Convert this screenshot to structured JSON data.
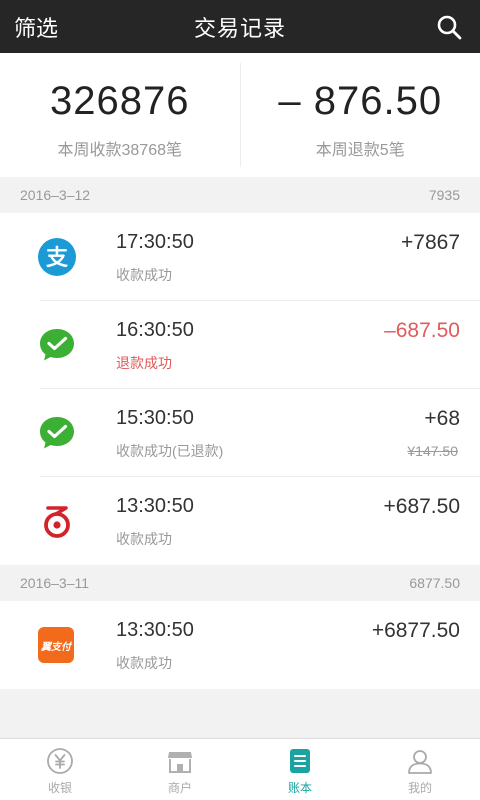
{
  "header": {
    "filter_label": "筛选",
    "title": "交易记录"
  },
  "summary": {
    "income_value": "326876",
    "income_label": "本周收款38768笔",
    "refund_value": "– 876.50",
    "refund_label": "本周退款5笔"
  },
  "groups": [
    {
      "date": "2016–3–12",
      "total": "7935",
      "items": [
        {
          "icon": "alipay-icon",
          "time": "17:30:50",
          "status": "收款成功",
          "amount": "+7867"
        },
        {
          "icon": "wechat-pay-icon",
          "time": "16:30:50",
          "status": "退款成功",
          "amount": "–687.50"
        },
        {
          "icon": "wechat-pay-icon",
          "time": "15:30:50",
          "status": "收款成功(已退款)",
          "amount": "+68",
          "original": "¥147.50"
        },
        {
          "icon": "lakala-icon",
          "time": "13:30:50",
          "status": "收款成功",
          "amount": "+687.50"
        }
      ]
    },
    {
      "date": "2016–3–11",
      "total": "6877.50",
      "items": [
        {
          "icon": "yizhifu-icon",
          "icon_text": "翼支付",
          "time": "13:30:50",
          "status": "收款成功",
          "amount": "+6877.50"
        }
      ]
    }
  ],
  "tabs": [
    {
      "label": "收银",
      "icon": "cashier-icon"
    },
    {
      "label": "商户",
      "icon": "store-icon"
    },
    {
      "label": "账本",
      "icon": "ledger-icon",
      "active": true
    },
    {
      "label": "我的",
      "icon": "profile-icon"
    }
  ],
  "colors": {
    "header_bg": "#262626",
    "accent": "#1aa3a0",
    "refund_red": "#e25a5a",
    "alipay_blue": "#1c9ad6",
    "wechat_green": "#3cb034",
    "lakala_red": "#d2232a",
    "yizhifu_orange": "#f26b1d"
  }
}
